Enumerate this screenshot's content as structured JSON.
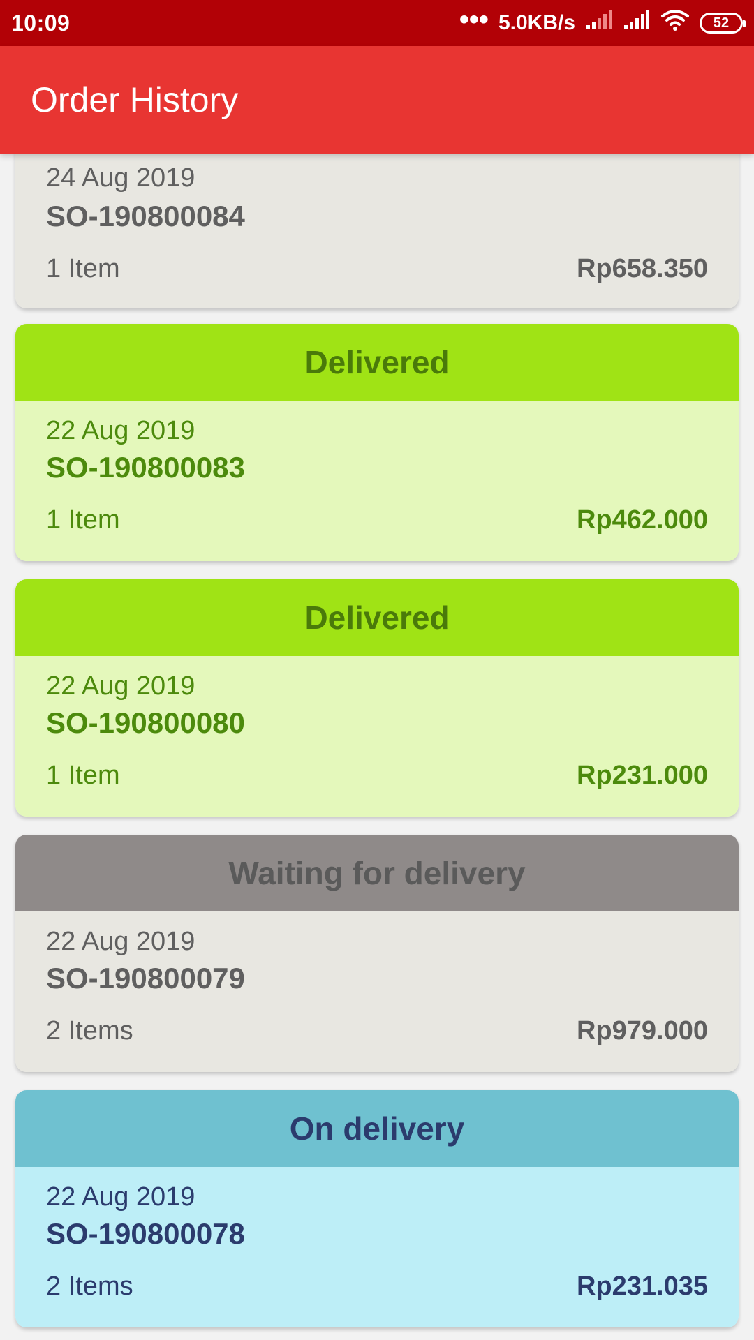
{
  "status_bar": {
    "time": "10:09",
    "dots": "•••",
    "speed": "5.0KB/s",
    "battery": "52",
    "icons": [
      "signal-icon",
      "signal-icon",
      "wifi-icon",
      "battery-icon"
    ]
  },
  "app_bar": {
    "title": "Order History"
  },
  "orders": [
    {
      "status": "",
      "date": "24 Aug 2019",
      "id": "SO-190800084",
      "items": "1 Item",
      "total": "Rp658.350"
    },
    {
      "status": "Delivered",
      "date": "22 Aug 2019",
      "id": "SO-190800083",
      "items": "1 Item",
      "total": "Rp462.000"
    },
    {
      "status": "Delivered",
      "date": "22 Aug 2019",
      "id": "SO-190800080",
      "items": "1 Item",
      "total": "Rp231.000"
    },
    {
      "status": "Waiting for delivery",
      "date": "22 Aug 2019",
      "id": "SO-190800079",
      "items": "2 Items",
      "total": "Rp979.000"
    },
    {
      "status": "On delivery",
      "date": "22 Aug 2019",
      "id": "SO-190800078",
      "items": "2 Items",
      "total": "Rp231.035"
    }
  ],
  "colors": {
    "status_bar": "#b20106",
    "app_bar": "#e83532",
    "delivered_header": "#a0e315",
    "delivered_body": "#e4f8bb",
    "waiting_header": "#8f8a89",
    "waiting_body": "#e8e7e1",
    "on_delivery_header": "#6fc1d0",
    "on_delivery_body": "#bdeef7"
  }
}
